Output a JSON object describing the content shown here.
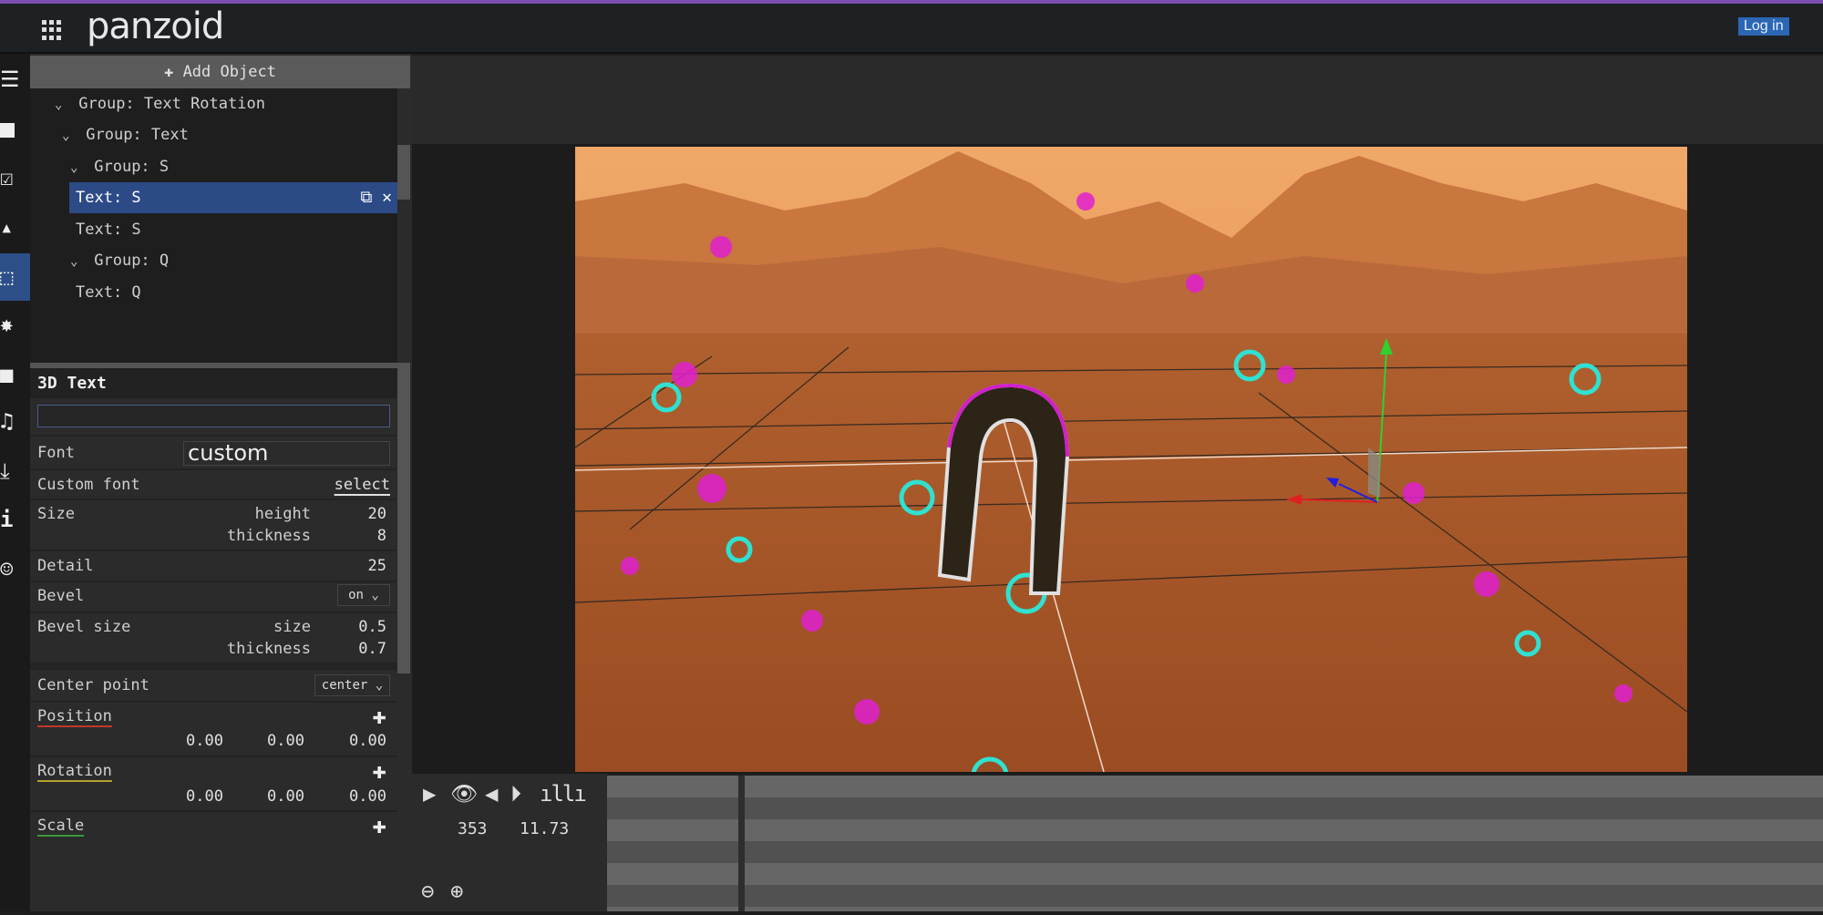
{
  "header": {
    "logo": "panzoid",
    "login_label": "Log in",
    "apps_icon": "grid-icon"
  },
  "rail": {
    "icons": [
      "menu-icon",
      "rectangle-icon",
      "checkbox-icon",
      "image-icon",
      "3d-cube-icon",
      "burst-icon",
      "camera-icon",
      "music-icon",
      "download-icon",
      "info-icon",
      "smiley-icon"
    ],
    "active": "3d-cube-icon"
  },
  "objects": {
    "add_label": "Add Object",
    "tree": [
      {
        "label": "Group: Text Rotation",
        "group": true
      },
      {
        "label": "Group: Text",
        "group": true
      },
      {
        "label": "Group: S",
        "group": true
      },
      {
        "label": "Text: S",
        "group": false,
        "selected": true
      },
      {
        "label": "Text: S",
        "group": false
      },
      {
        "label": "Group: Q",
        "group": true
      },
      {
        "label": "Text: Q",
        "group": false
      }
    ]
  },
  "props": {
    "title": "3D Text",
    "text_value": "",
    "font_label": "Font",
    "font_value": "custom",
    "custom_font_label": "Custom font",
    "custom_font_link": "select",
    "size_label": "Size",
    "height_label": "height",
    "height_value": "20",
    "thickness_label": "thickness",
    "thickness_value": "8",
    "detail_label": "Detail",
    "detail_value": "25",
    "bevel_label": "Bevel",
    "bevel_value": "on",
    "bevel_size_label": "Bevel size",
    "bevel_sub_size": "size",
    "bevel_size_value": "0.5",
    "bevel_sub_thickness": "thickness",
    "bevel_thickness_value": "0.7",
    "center_label": "Center point",
    "center_value": "center",
    "position_label": "Position",
    "position": [
      "0.00",
      "0.00",
      "0.00"
    ],
    "rotation_label": "Rotation",
    "rotation": [
      "0.00",
      "0.00",
      "0.00"
    ],
    "scale_label": "Scale",
    "colors": {
      "position": "#c0392b",
      "rotation": "#b5a12a",
      "scale": "#3a9a3a"
    }
  },
  "timeline": {
    "frame": "353",
    "time": "11.73"
  },
  "colors": {
    "accent": "#2c4f8a",
    "login": "#2b67b3",
    "topline": "#7a4fb0"
  }
}
